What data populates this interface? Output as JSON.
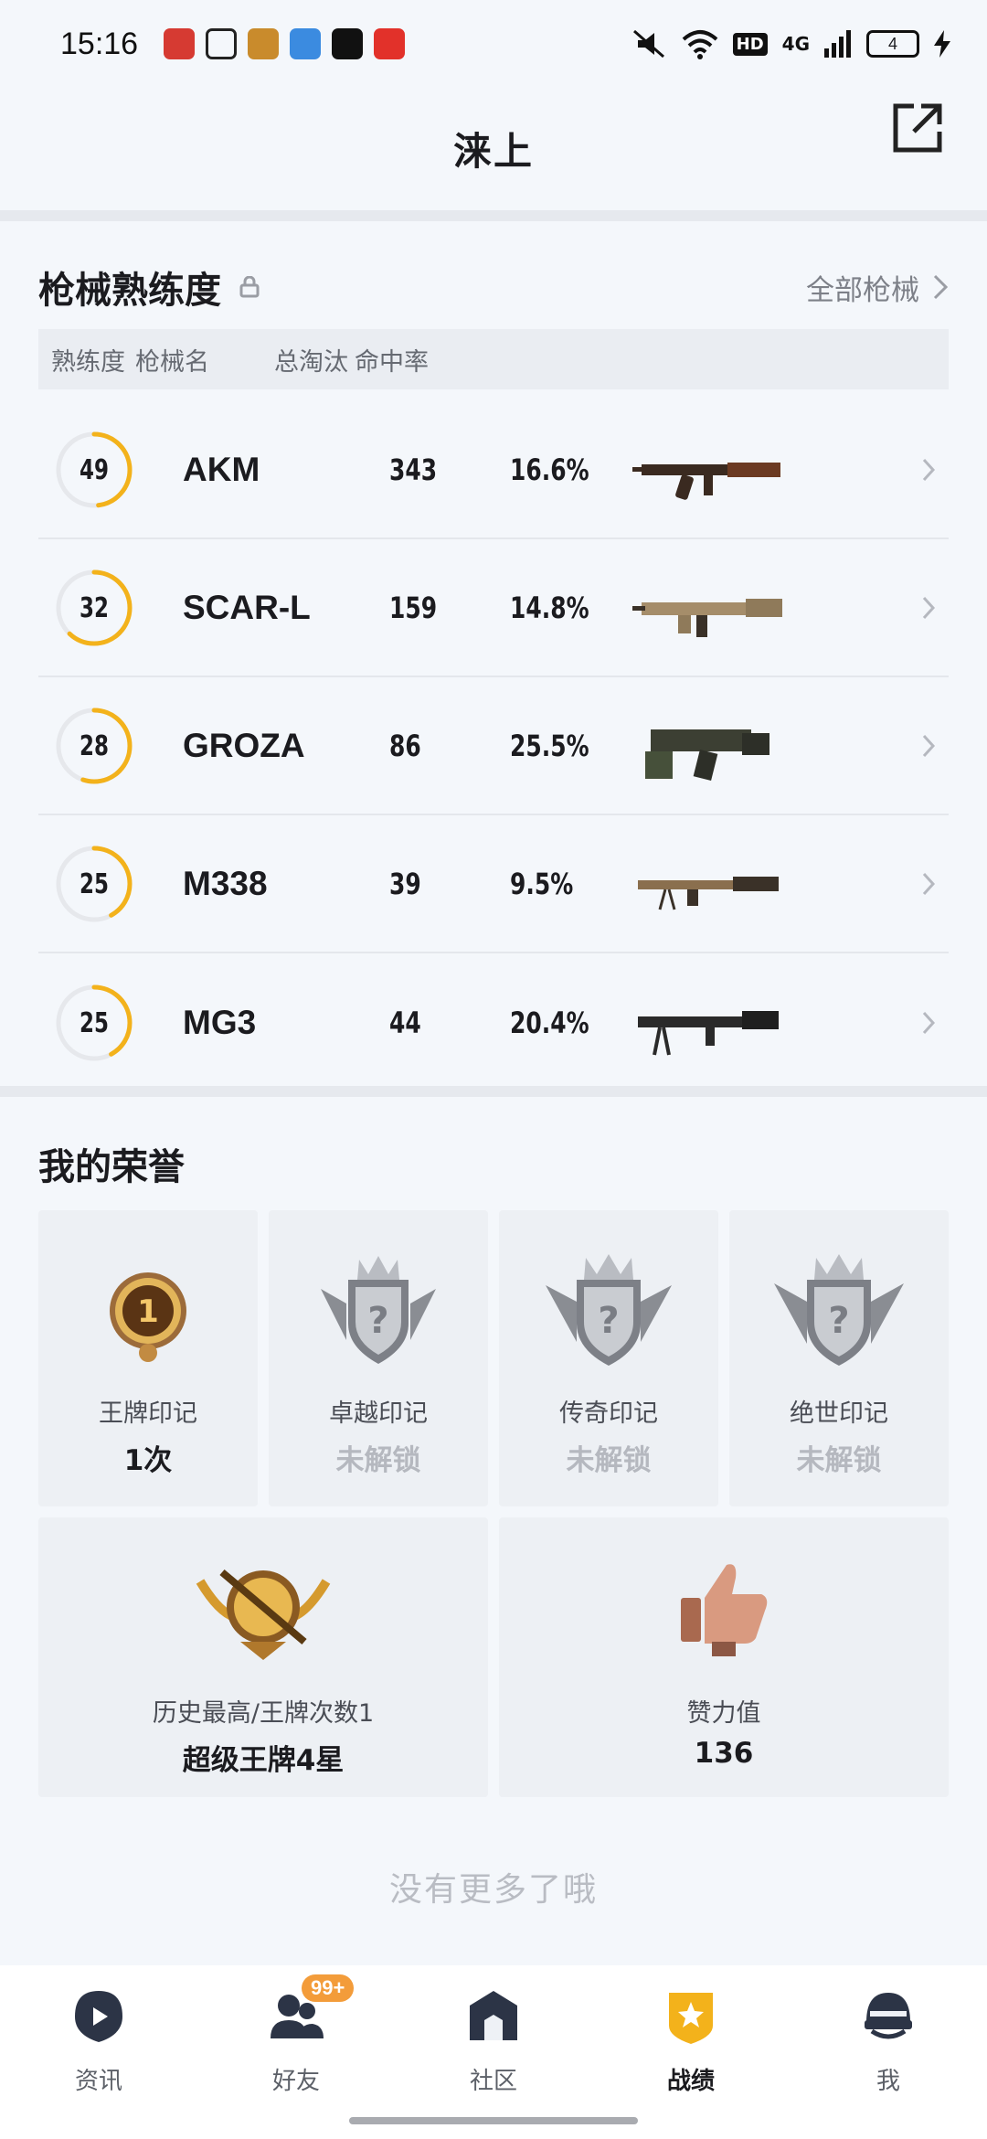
{
  "status_bar": {
    "time": "15:16",
    "signal": "4G",
    "hd": "HD",
    "battery": "4"
  },
  "header": {
    "title": "涞上"
  },
  "weapon_section": {
    "title": "枪械熟练度",
    "all_link": "全部枪械",
    "columns": [
      "熟练度",
      "枪械名",
      "总淘汰",
      "命中率"
    ],
    "rows": [
      {
        "level": "49",
        "level_progress": 0.48,
        "name": "AKM",
        "kills": "343",
        "hit_rate": "16.6%"
      },
      {
        "level": "32",
        "level_progress": 0.62,
        "name": "SCAR-L",
        "kills": "159",
        "hit_rate": "14.8%"
      },
      {
        "level": "28",
        "level_progress": 0.55,
        "name": "GROZA",
        "kills": "86",
        "hit_rate": "25.5%"
      },
      {
        "level": "25",
        "level_progress": 0.42,
        "name": "M338",
        "kills": "39",
        "hit_rate": "9.5%"
      },
      {
        "level": "25",
        "level_progress": 0.42,
        "name": "MG3",
        "kills": "44",
        "hit_rate": "20.4%"
      }
    ]
  },
  "honors": {
    "title": "我的荣誉",
    "badges": [
      {
        "label": "王牌印记",
        "value": "1次"
      },
      {
        "label": "卓越印记",
        "value": "未解锁"
      },
      {
        "label": "传奇印记",
        "value": "未解锁"
      },
      {
        "label": "绝世印记",
        "value": "未解锁"
      }
    ],
    "highest": {
      "label": "历史最高/王牌次数1",
      "value": "超级王牌4星"
    },
    "likes": {
      "label": "赞力值",
      "value": "136"
    }
  },
  "footer_text": "没有更多了哦",
  "bottom_nav": {
    "tabs": [
      "资讯",
      "好友",
      "社区",
      "战绩",
      "我"
    ],
    "friends_badge": "99+",
    "active": "战绩"
  },
  "colors": {
    "accent": "#f3b21b",
    "background": "#f4f7fb",
    "card": "#edf0f4"
  }
}
